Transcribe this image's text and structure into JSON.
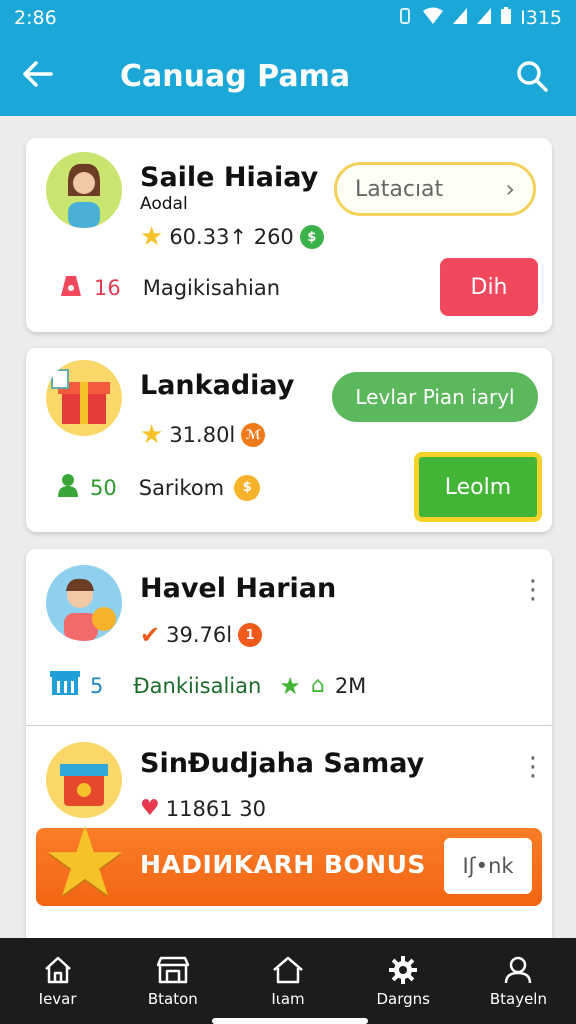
{
  "status_bar": {
    "time": "2:86",
    "battery": "I315"
  },
  "app_bar": {
    "title": "Canuag Pama"
  },
  "cards": [
    {
      "name": "Saile Hiaiay",
      "sub": "Aodal",
      "points": "60.33↑ 260",
      "level_label": "16",
      "tag": "Magikisahian",
      "select_label": "Latacıat",
      "action_label": "Dih"
    },
    {
      "name": "Lankadiay",
      "points": "31.80l",
      "level_label": "50",
      "tag": "Sarikom",
      "pill_label": "Levlar Pian iaryl",
      "action_label": "Leolm"
    },
    {
      "name": "Havel Harian",
      "points": "39.76l",
      "level_label": "5",
      "tag": "Ðankiisalian",
      "reward": "2M"
    },
    {
      "name": "SinÐudjaha Samay",
      "points": "11861 30"
    }
  ],
  "bonus": {
    "label": "HADIИKARH BONUS",
    "button": "Iʃ•nk"
  },
  "nav": [
    {
      "label": "Ιevar",
      "icon": "home-icon"
    },
    {
      "label": "Btaton",
      "icon": "store-icon"
    },
    {
      "label": "Ιιam",
      "icon": "house-icon"
    },
    {
      "label": "Dargns",
      "icon": "gear-icon"
    },
    {
      "label": "Btayeln",
      "icon": "profile-icon"
    }
  ],
  "colors": {
    "primary": "#1ba8d8",
    "red": "#f0495d",
    "green": "#43b536",
    "orange": "#f26513",
    "gold": "#f5c22a",
    "nav_bg": "#1c1c1c"
  }
}
